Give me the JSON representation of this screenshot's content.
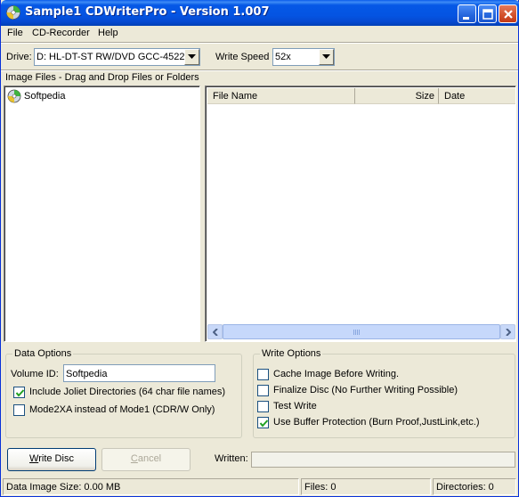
{
  "window": {
    "title": "Sample1 CDWriterPro - Version 1.007",
    "title_icon": "cd-disc-icon",
    "watermark": "SOFTPEDIA"
  },
  "menu": {
    "items": [
      "File",
      "CD-Recorder",
      "Help"
    ]
  },
  "drive_row": {
    "drive_label": "Drive:",
    "drive_value": "D: HL-DT-ST RW/DVD GCC-4522",
    "write_speed_label": "Write Speed",
    "write_speed_value": "52x"
  },
  "image_files_header": "Image Files - Drag and Drop Files or Folders",
  "tree": {
    "items": [
      {
        "label": "Softpedia",
        "icon": "cd-disc-icon"
      }
    ]
  },
  "file_list": {
    "columns": [
      "File Name",
      "Size",
      "Date"
    ],
    "rows": []
  },
  "data_options": {
    "title": "Data Options",
    "volume_id_label": "Volume ID:",
    "volume_id_value": "Softpedia",
    "joliet_label": "Include Joliet Directories (64 char file names)",
    "joliet_checked": true,
    "mode2_label": "Mode2XA instead of Mode1 (CDR/W Only)",
    "mode2_checked": false
  },
  "write_options": {
    "title": "Write Options",
    "cache_label": "Cache Image Before Writing.",
    "cache_checked": false,
    "finalize_label": "Finalize Disc (No Further Writing Possible)",
    "finalize_checked": false,
    "test_label": "Test Write",
    "test_checked": false,
    "buffer_label": "Use Buffer Protection (Burn Proof,JustLink,etc.)",
    "buffer_checked": true
  },
  "actions": {
    "write_disc_pre": "",
    "write_disc_ul": "W",
    "write_disc_post": "rite Disc",
    "cancel_pre": "",
    "cancel_ul": "C",
    "cancel_post": "ancel",
    "written_label": "Written:",
    "written_progress": 0
  },
  "status_bar": {
    "data_image_size": "Data Image Size: 0.00 MB",
    "files": "Files: 0",
    "directories": "Directories: 0"
  },
  "colors": {
    "titlebar": "#0454e2",
    "window_bg": "#ece9d8",
    "checkbox_border": "#1c5180"
  }
}
